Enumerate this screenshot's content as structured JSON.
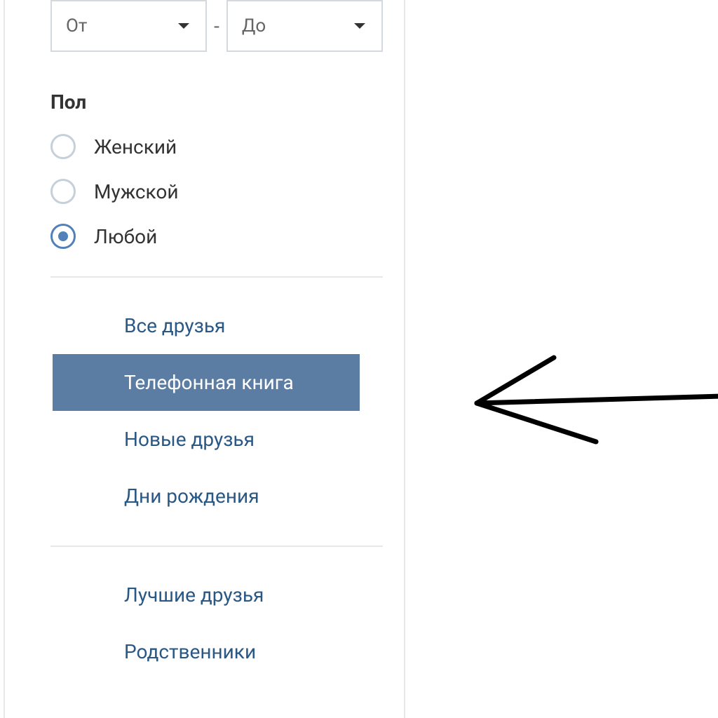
{
  "range": {
    "from_label": "От",
    "to_label": "До",
    "separator": "-"
  },
  "gender": {
    "label": "Пол",
    "options": [
      {
        "label": "Женский",
        "selected": false
      },
      {
        "label": "Мужской",
        "selected": false
      },
      {
        "label": "Любой",
        "selected": true
      }
    ]
  },
  "nav_section_1": [
    {
      "label": "Все друзья",
      "active": false
    },
    {
      "label": "Телефонная книга",
      "active": true
    },
    {
      "label": "Новые друзья",
      "active": false
    },
    {
      "label": "Дни рождения",
      "active": false
    }
  ],
  "nav_section_2": [
    {
      "label": "Лучшие друзья",
      "active": false
    },
    {
      "label": "Родственники",
      "active": false
    }
  ]
}
